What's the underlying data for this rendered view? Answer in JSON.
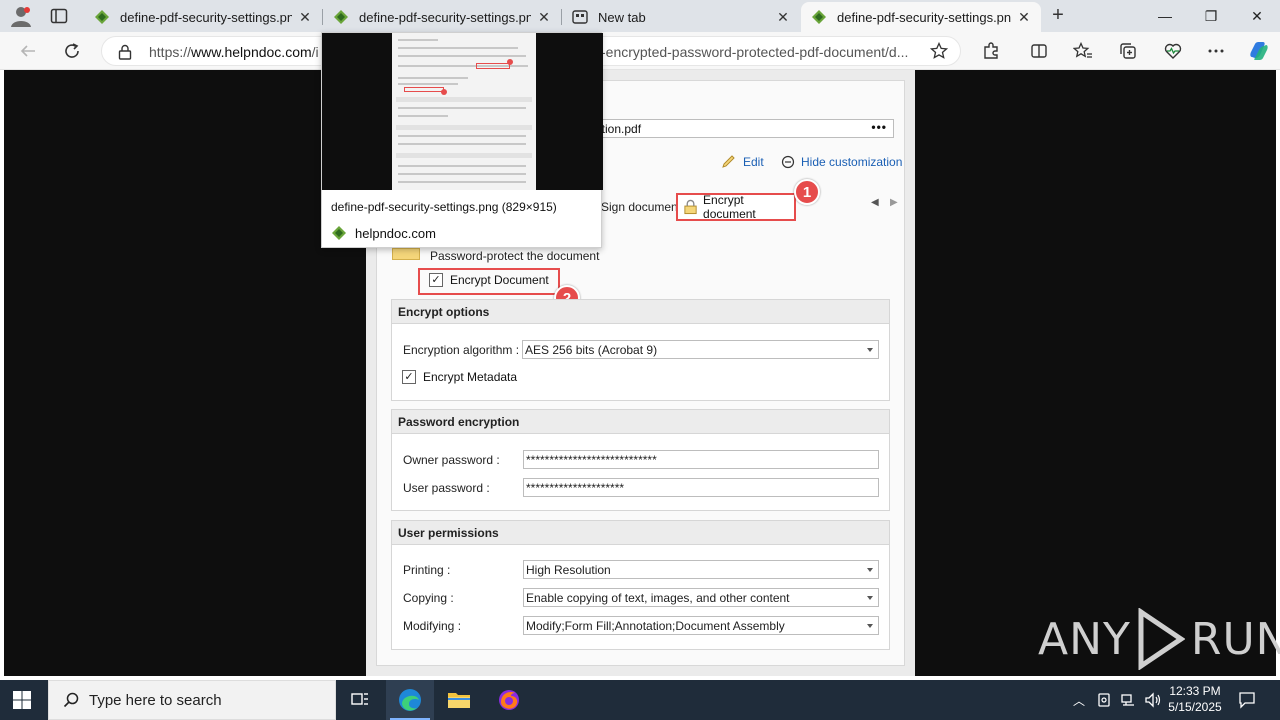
{
  "browser": {
    "tabs": [
      {
        "title": "define-pdf-security-settings.png",
        "close": "✕",
        "active": false
      },
      {
        "title": "define-pdf-security-settings.png",
        "close": "✕",
        "active": false
      },
      {
        "title": "New tab",
        "close": "✕",
        "active": false
      },
      {
        "title": "define-pdf-security-settings.png",
        "close": "✕",
        "active": true
      }
    ],
    "new_tab_label": "+",
    "window_controls": {
      "minimize": "—",
      "maximize": "❐",
      "close": "✕"
    },
    "address": {
      "url_prefix": "https://",
      "url_host": "www.helpndoc.com",
      "url_path_left": "/i",
      "url_path_right": "-encrypted-password-protected-pdf-document/d..."
    }
  },
  "tooltip": {
    "filename": "define-pdf-security-settings.png (829×915)",
    "site": "helpndoc.com"
  },
  "page": {
    "filename_field": "ntation.pdf",
    "filename_dots": "•••",
    "edit_link": "Edit",
    "hide_link": "Hide customization",
    "tab_sign": "Sign document",
    "tab_encrypt": "Encrypt document",
    "badge1": "1",
    "badge2": "2",
    "protect_label": "Password-protect the document",
    "encrypt_document": "Encrypt Document",
    "encrypt_options": {
      "header": "Encrypt options",
      "algorithm_label": "Encryption algorithm :",
      "algorithm_value": "AES 256 bits (Acrobat 9)",
      "metadata_label": "Encrypt Metadata"
    },
    "password_encryption": {
      "header": "Password encryption",
      "owner_label": "Owner password :",
      "owner_value": "****************************",
      "user_label": "User password :",
      "user_value": "*********************"
    },
    "user_permissions": {
      "header": "User permissions",
      "printing_label": "Printing :",
      "printing_value": "High Resolution",
      "copying_label": "Copying :",
      "copying_value": "Enable copying of text, images, and other content",
      "modifying_label": "Modifying :",
      "modifying_value": "Modify;Form Fill;Annotation;Document Assembly"
    }
  },
  "watermark": {
    "left": "ANY",
    "right": "RUN"
  },
  "taskbar": {
    "search_placeholder": "Type here to search",
    "time": "12:33 PM",
    "date": "5/15/2025"
  },
  "colors": {
    "highlight": "#e64c4c",
    "link": "#1a5fb4",
    "taskbar": "#1f2c3a"
  }
}
